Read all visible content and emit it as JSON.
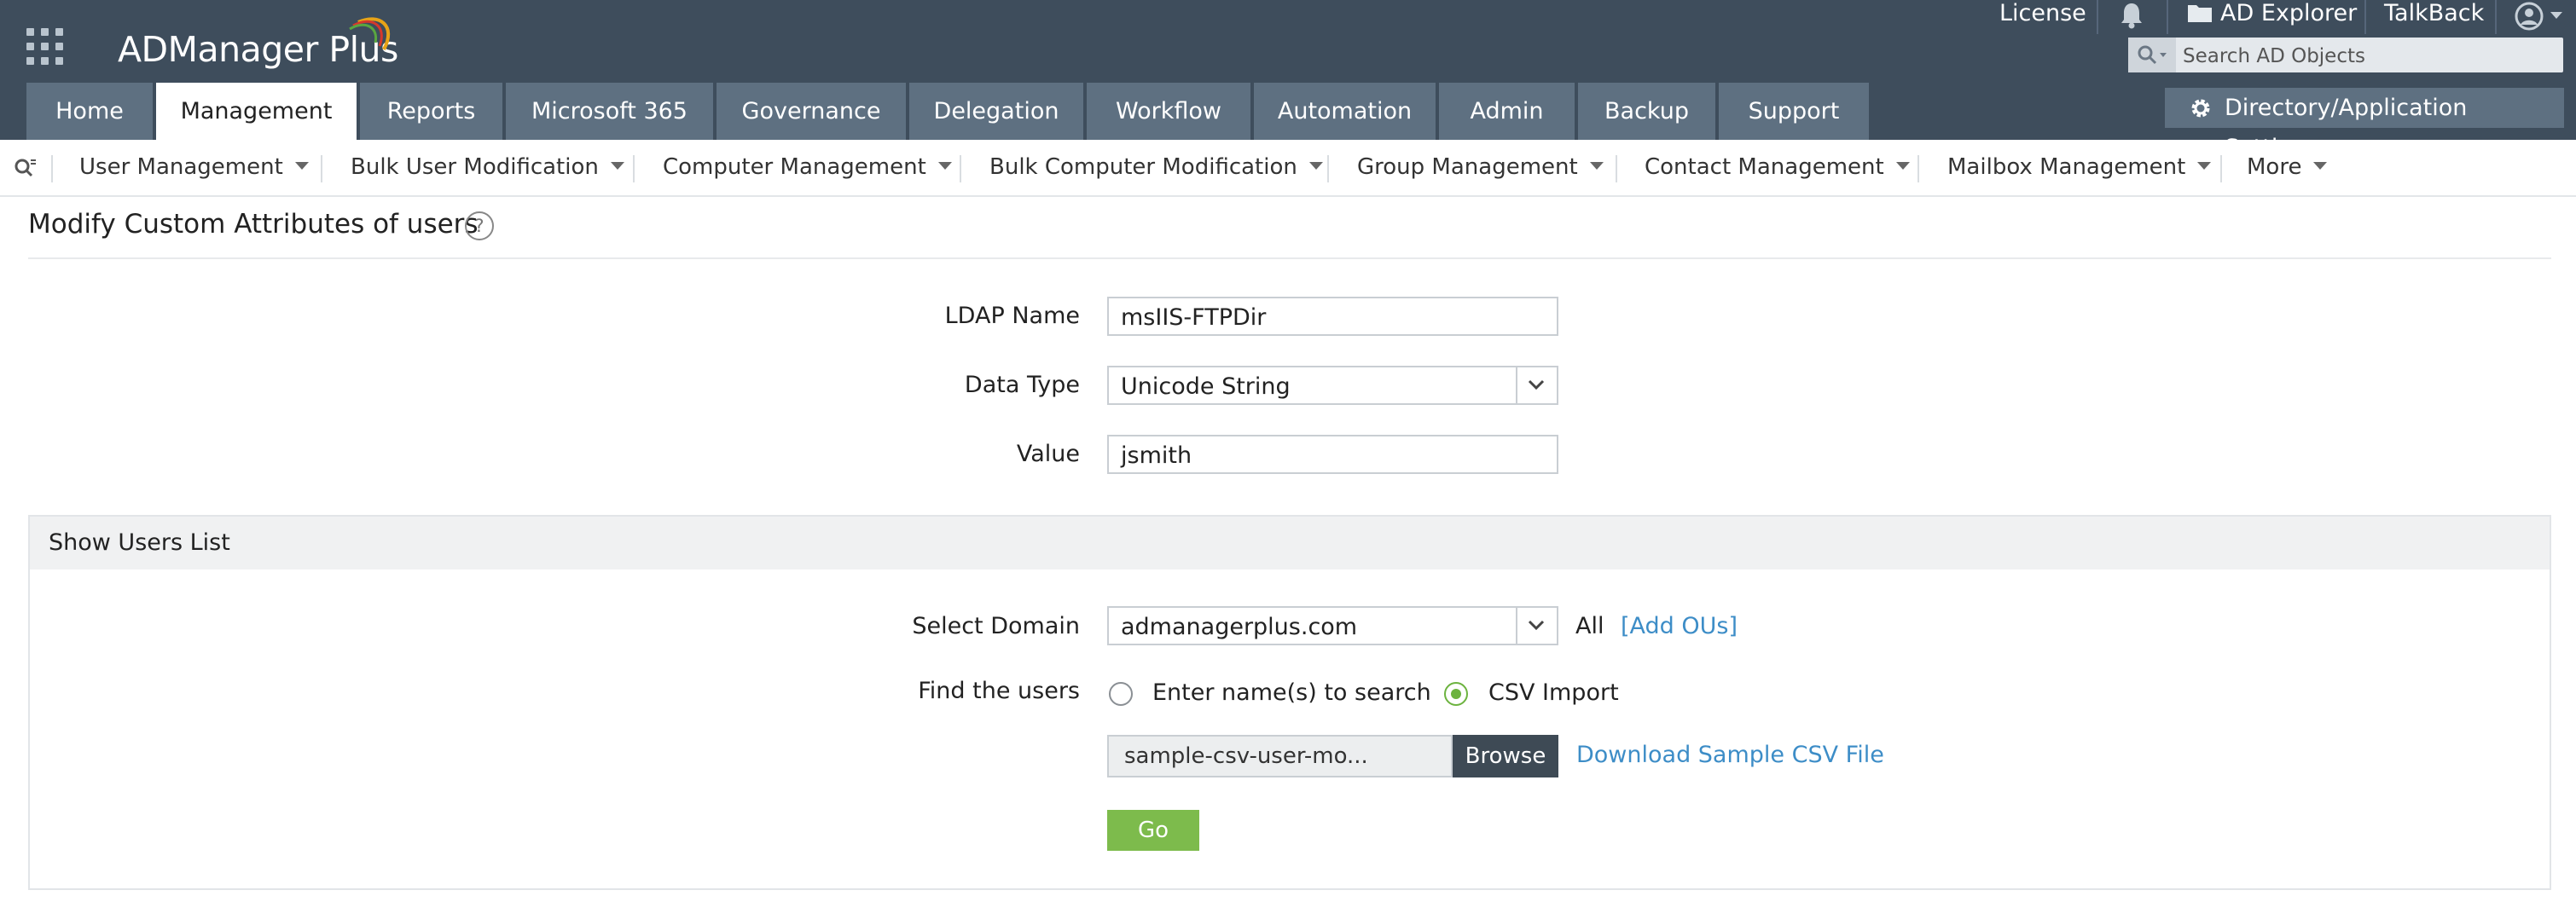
{
  "header": {
    "logo_text": "ADManager Plus",
    "top_links": {
      "license": "License",
      "ad_explorer": "AD Explorer",
      "talkback": "TalkBack"
    },
    "search": {
      "placeholder": "Search AD Objects"
    },
    "tabs": [
      {
        "label": "Home"
      },
      {
        "label": "Management",
        "active": true
      },
      {
        "label": "Reports"
      },
      {
        "label": "Microsoft 365"
      },
      {
        "label": "Governance"
      },
      {
        "label": "Delegation"
      },
      {
        "label": "Workflow"
      },
      {
        "label": "Automation"
      },
      {
        "label": "Admin"
      },
      {
        "label": "Backup"
      },
      {
        "label": "Support"
      }
    ],
    "settings_button": "Directory/Application Settings"
  },
  "subnav": {
    "items": [
      {
        "label": "User Management"
      },
      {
        "label": "Bulk User Modification"
      },
      {
        "label": "Computer Management"
      },
      {
        "label": "Bulk Computer Modification"
      },
      {
        "label": "Group Management"
      },
      {
        "label": "Contact Management"
      },
      {
        "label": "Mailbox Management"
      },
      {
        "label": "More"
      }
    ]
  },
  "page": {
    "title": "Modify Custom Attributes of users",
    "help_glyph": "?"
  },
  "form": {
    "ldap_name_label": "LDAP Name",
    "ldap_name_value": "msIIS-FTPDir",
    "data_type_label": "Data Type",
    "data_type_value": "Unicode String",
    "value_label": "Value",
    "value_value": "jsmith"
  },
  "users_panel": {
    "header": "Show Users List",
    "select_domain_label": "Select Domain",
    "domain_value": "admanagerplus.com",
    "all_text": "All",
    "add_ous_link": "[Add OUs]",
    "find_users_label": "Find the users",
    "option_search": "Enter name(s) to search",
    "option_csv": "CSV Import",
    "selected_option": "csv",
    "file_name": "sample-csv-user-mo...",
    "browse_button": "Browse",
    "download_link": "Download Sample CSV File",
    "go_button": "Go"
  },
  "colors": {
    "header_bg": "#3e4d5c",
    "tab_bg": "#5e7081",
    "accent_green": "#7dbb4c",
    "link_blue": "#3d8dc7"
  }
}
